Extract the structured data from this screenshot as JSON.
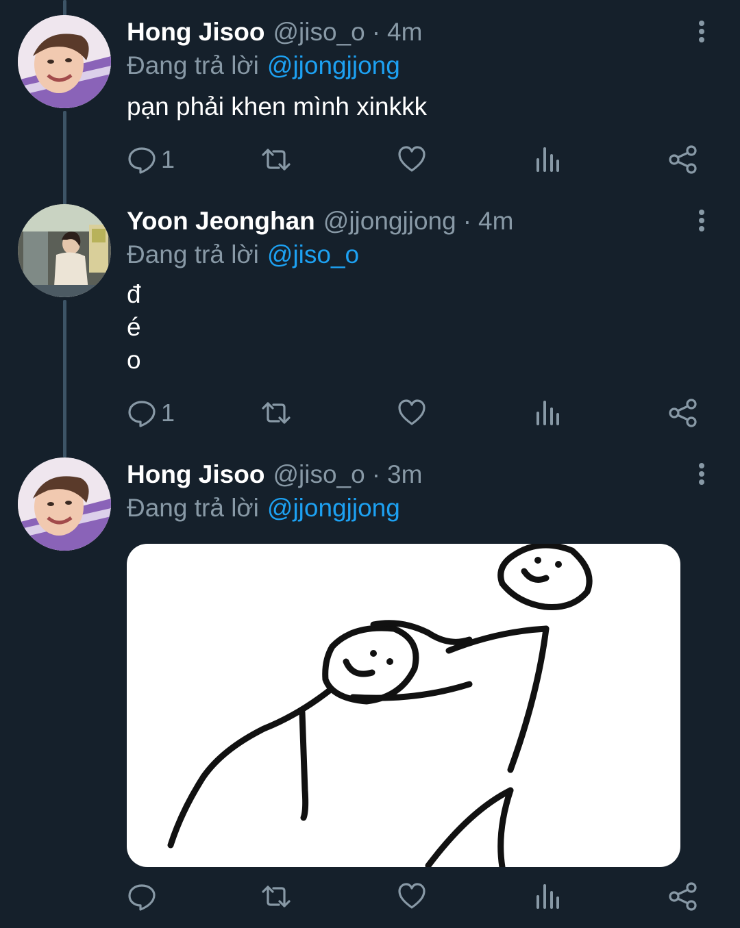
{
  "tweets": [
    {
      "author": "Hong Jisoo",
      "handle": "@jiso_o",
      "separator": "·",
      "time": "4m",
      "reply_label": "Đang trả lời",
      "reply_to": "@jjongjjong",
      "text": "pạn phải khen mình xinkkk",
      "reply_count": "1"
    },
    {
      "author": "Yoon Jeonghan",
      "handle": "@jjongjjong",
      "separator": "·",
      "time": "4m",
      "reply_label": "Đang trả lời",
      "reply_to": "@jiso_o",
      "text_lines": [
        "đ",
        "é",
        "o"
      ],
      "reply_count": "1"
    },
    {
      "author": "Hong Jisoo",
      "handle": "@jiso_o",
      "separator": "·",
      "time": "3m",
      "reply_label": "Đang trả lời",
      "reply_to": "@jjongjjong",
      "reply_count": ""
    }
  ],
  "colors": {
    "background": "#15202b",
    "muted": "#8899a6",
    "link": "#1da1f2",
    "thread_line": "#3d5466"
  },
  "icons": [
    "reply-icon",
    "retweet-icon",
    "like-icon",
    "analytics-icon",
    "share-icon",
    "more-icon"
  ]
}
